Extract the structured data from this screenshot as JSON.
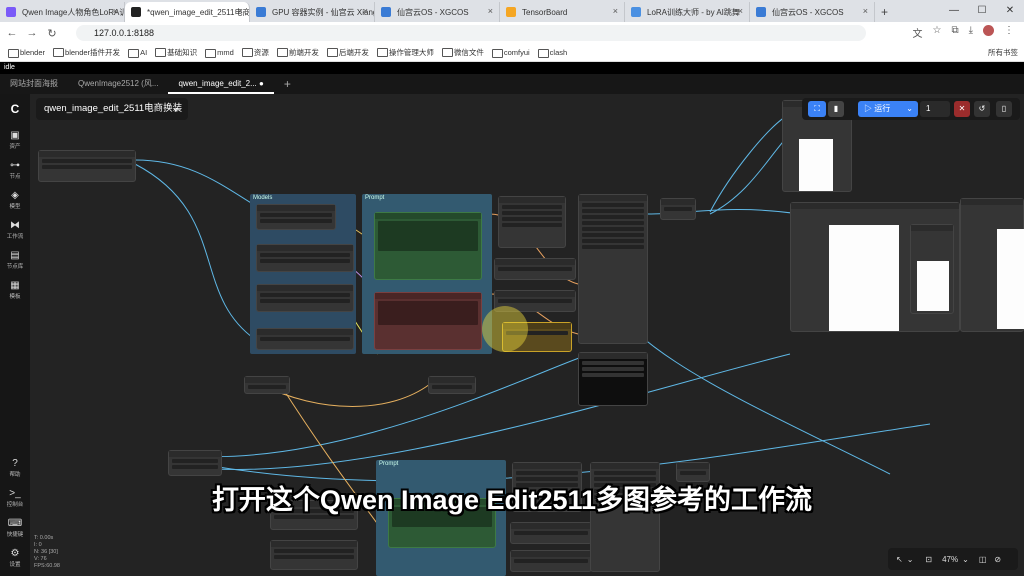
{
  "browser": {
    "tabs": [
      {
        "label": "Qwen Image人物角色LoRA训"
      },
      {
        "label": "*qwen_image_edit_2511电商"
      },
      {
        "label": "GPU 容器实例 - 仙宫云 Xiang"
      },
      {
        "label": "仙宫云OS - XGCOS"
      },
      {
        "label": "TensorBoard"
      },
      {
        "label": "LoRA训练大师 - by AI跳舞"
      },
      {
        "label": "仙宫云OS - XGCOS"
      }
    ],
    "new_tab": "+",
    "url": "127.0.0.1:8188",
    "bookmarks": [
      "blender",
      "blender插件开发",
      "AI",
      "基础知识",
      "mmd",
      "资源",
      "前端开发",
      "后端开发",
      "操作管理大师",
      "微信文件",
      "comfyui",
      "clash"
    ],
    "bookmarks_right": "所有书签"
  },
  "app": {
    "status": "idle",
    "workflow_tabs": [
      {
        "label": "网站封面海报"
      },
      {
        "label": "QwenImage2512 (风..."
      },
      {
        "label": "qwen_image_edit_2..."
      }
    ],
    "add_tab": "+",
    "workflow_name": "qwen_image_edit_2511电商换装",
    "run_label": "运行",
    "batch_count": "1",
    "zoom": "47%"
  },
  "sidebar": {
    "items": [
      {
        "label": "资产",
        "icon": "folder-icon"
      },
      {
        "label": "节点",
        "icon": "node-icon"
      },
      {
        "label": "模型",
        "icon": "cube-icon"
      },
      {
        "label": "工作流",
        "icon": "workflow-icon"
      },
      {
        "label": "节点库",
        "icon": "library-icon"
      },
      {
        "label": "模板",
        "icon": "template-icon"
      },
      {
        "label": "帮助",
        "icon": "help-icon"
      },
      {
        "label": "控制台",
        "icon": "terminal-icon"
      },
      {
        "label": "快捷键",
        "icon": "keyboard-icon"
      },
      {
        "label": "设置",
        "icon": "gear-icon"
      }
    ]
  },
  "canvas": {
    "groups": [
      {
        "label": "Models"
      },
      {
        "label": "Prompt"
      },
      {
        "label": "Prompt"
      }
    ],
    "stats": [
      "T: 0.00s",
      "I: 0",
      "N: 36 [30]",
      "V: 76",
      "FPS:60.98"
    ]
  },
  "subtitle": "打开这个Qwen Image Edit2511多图参考的工作流",
  "colors": {
    "accent_blue": "#3b82f6",
    "group_models": "#2e4b63",
    "group_prompt": "#335a70",
    "node_green": "#2d5a35",
    "node_red": "#5a3030",
    "link_blue": "#5fb8e6"
  }
}
